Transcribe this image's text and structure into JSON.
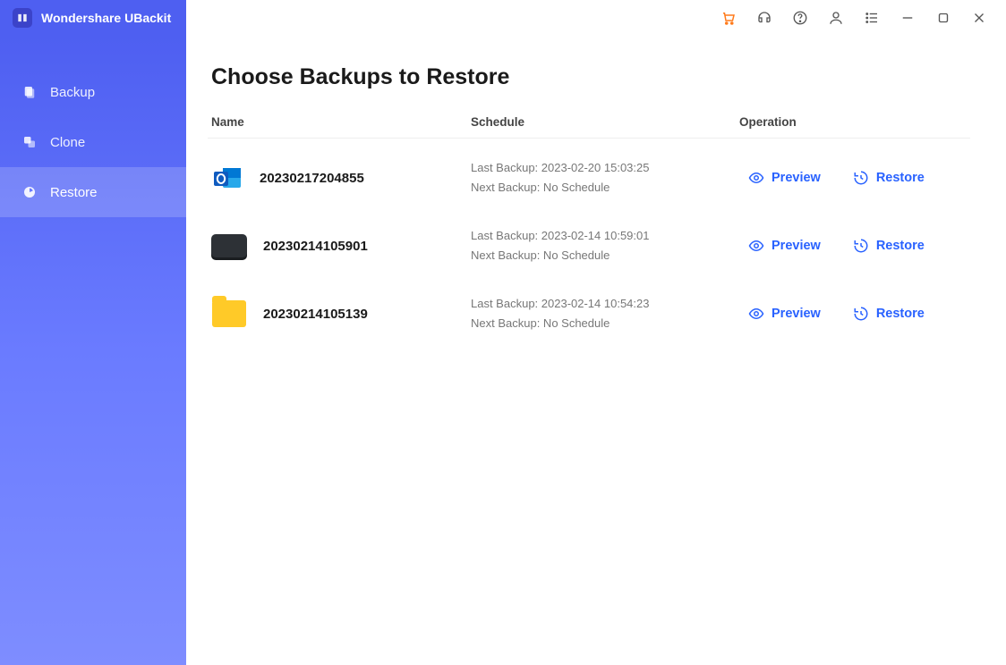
{
  "app": {
    "title": "Wondershare UBackit"
  },
  "sidebar": {
    "items": [
      {
        "label": "Backup"
      },
      {
        "label": "Clone"
      },
      {
        "label": "Restore"
      }
    ],
    "active_index": 2
  },
  "page": {
    "title": "Choose Backups to Restore",
    "columns": {
      "name": "Name",
      "schedule": "Schedule",
      "operation": "Operation"
    },
    "last_backup_prefix": "Last Backup: ",
    "next_backup_prefix": "Next Backup: ",
    "preview_label": "Preview",
    "restore_label": "Restore",
    "rows": [
      {
        "icon": "outlook",
        "name": "20230217204855",
        "last_backup": "2023-02-20 15:03:25",
        "next_backup": "No Schedule"
      },
      {
        "icon": "disk",
        "name": "20230214105901",
        "last_backup": "2023-02-14 10:59:01",
        "next_backup": "No Schedule"
      },
      {
        "icon": "folder",
        "name": "20230214105139",
        "last_backup": "2023-02-14 10:54:23",
        "next_backup": "No Schedule"
      }
    ]
  }
}
